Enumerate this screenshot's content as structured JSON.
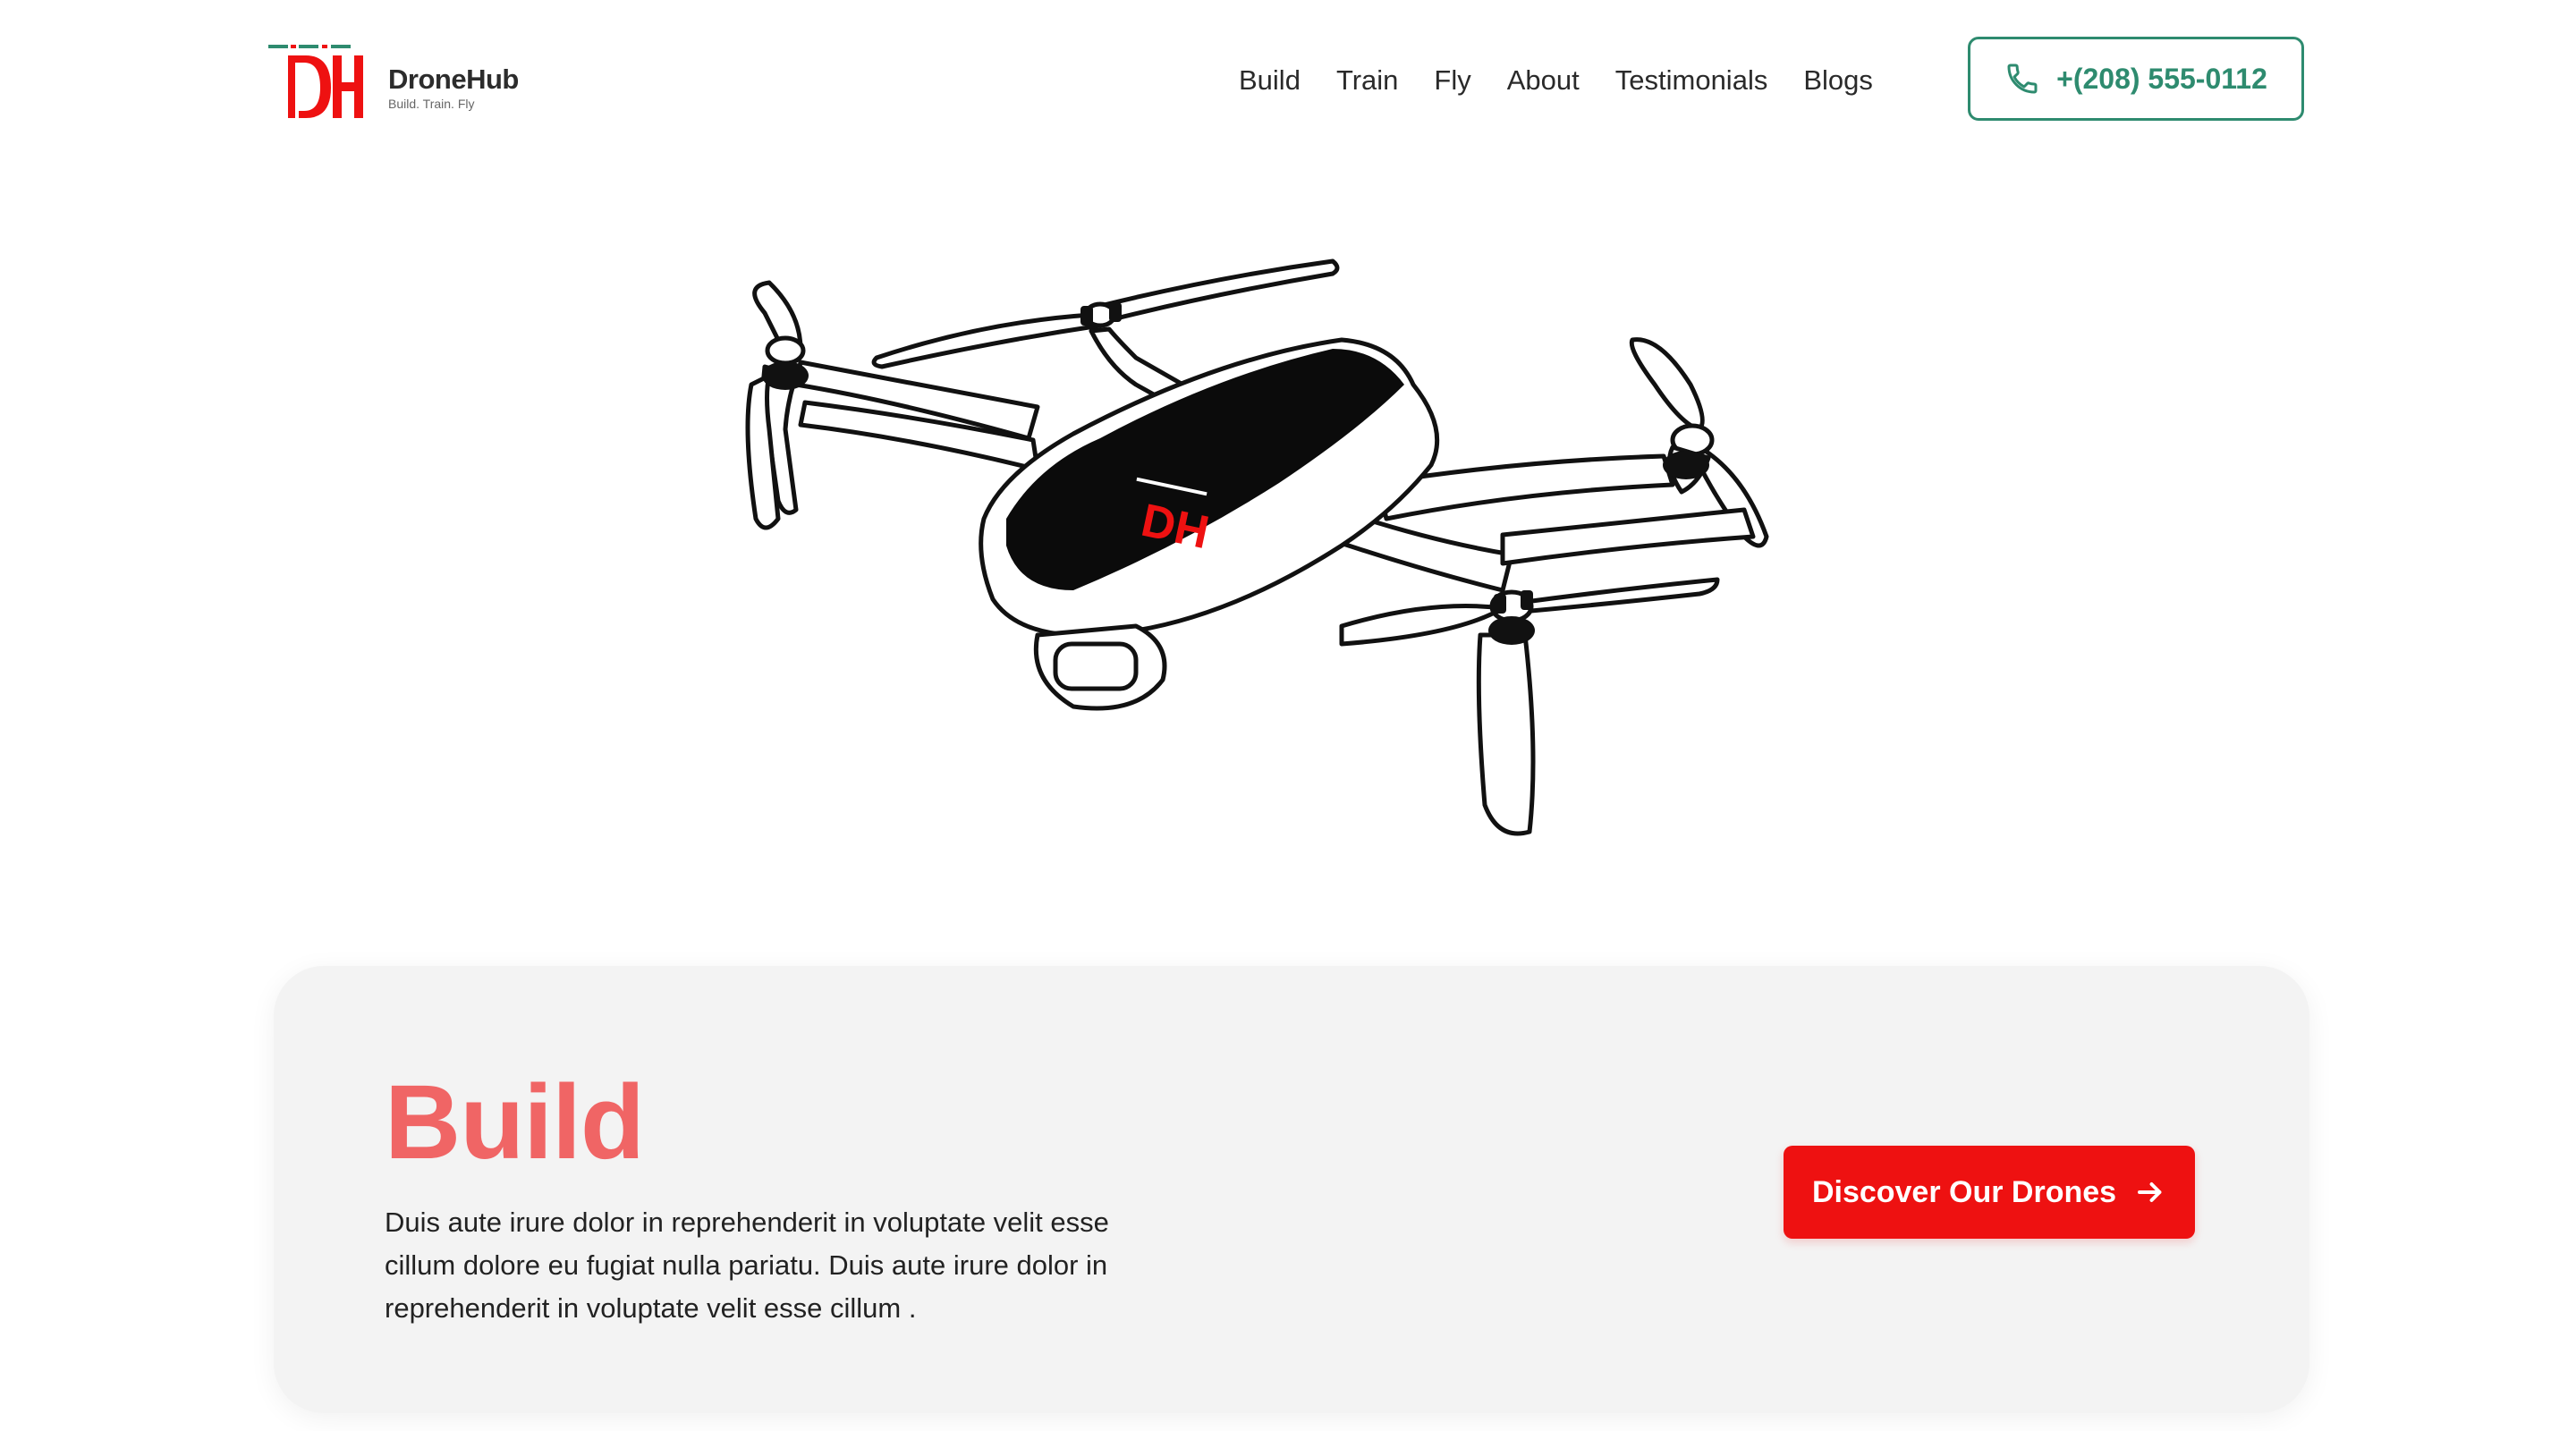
{
  "brand": {
    "name": "DroneHub",
    "tagline": "Build. Train. Fly",
    "logo_mark": "DH",
    "colors": {
      "primary_red": "#ee1111",
      "accent_green": "#2e8b6f",
      "title_coral": "#f06565"
    }
  },
  "nav": {
    "items": [
      "Build",
      "Train",
      "Fly",
      "About",
      "Testimonials",
      "Blogs"
    ]
  },
  "contact": {
    "phone": "+(208) 555-0112",
    "icon": "phone-icon"
  },
  "hero": {
    "illustration": "drone-illustration"
  },
  "card": {
    "title": "Build",
    "description": "Duis aute irure dolor in reprehenderit in voluptate velit esse cillum dolore eu fugiat nulla pariatu. Duis aute irure dolor in reprehenderit in voluptate velit esse cillum .",
    "cta_label": "Discover Our Drones",
    "cta_icon": "arrow-right-icon"
  }
}
